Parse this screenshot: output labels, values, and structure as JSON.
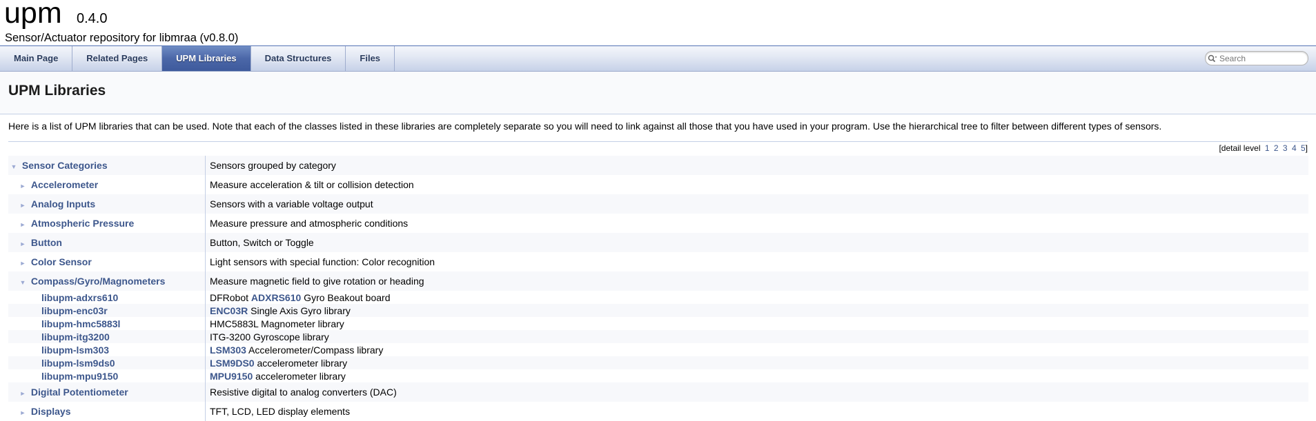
{
  "project": {
    "name": "upm",
    "number": "0.4.0",
    "brief": "Sensor/Actuator repository for libmraa (v0.8.0)"
  },
  "tabs": [
    {
      "label": "Main Page"
    },
    {
      "label": "Related Pages"
    },
    {
      "label": "UPM Libraries"
    },
    {
      "label": "Data Structures"
    },
    {
      "label": "Files"
    }
  ],
  "search": {
    "placeholder": "Search"
  },
  "page": {
    "title": "UPM Libraries",
    "intro": "Here is a list of UPM libraries that can be used. Note that each of the classes listed in these libraries are completely separate so you will need to link against all those that you have used in your program. Use the hierarchical tree to filter between different types of sensors.",
    "levels_prefix": "[detail level",
    "levels": [
      "1",
      "2",
      "3",
      "4",
      "5"
    ],
    "levels_suffix": "]"
  },
  "rows": [
    {
      "name": "Sensor Categories",
      "arrow": "▼",
      "desc": "Sensors grouped by category"
    },
    {
      "name": "Accelerometer",
      "arrow": "►",
      "desc": "Measure acceleration & tilt or collision detection"
    },
    {
      "name": "Analog Inputs",
      "arrow": "►",
      "desc": "Sensors with a variable voltage output"
    },
    {
      "name": "Atmospheric Pressure",
      "arrow": "►",
      "desc": "Measure pressure and atmospheric conditions"
    },
    {
      "name": "Button",
      "arrow": "►",
      "desc": "Button, Switch or Toggle"
    },
    {
      "name": "Color Sensor",
      "arrow": "►",
      "desc": "Light sensors with special function: Color recognition"
    },
    {
      "name": "Compass/Gyro/Magnometers",
      "arrow": "▼",
      "desc": "Measure magnetic field to give rotation or heading"
    },
    {
      "name": "libupm-adxrs610",
      "desc_before": "DFRobot ",
      "desc_link": "ADXRS610",
      "desc_after": " Gyro Beakout board"
    },
    {
      "name": "libupm-enc03r",
      "desc_before": "",
      "desc_link": "ENC03R",
      "desc_after": " Single Axis Gyro library"
    },
    {
      "name": "libupm-hmc5883l",
      "desc_before": "HMC5883L Magnometer library",
      "desc_link": "",
      "desc_after": ""
    },
    {
      "name": "libupm-itg3200",
      "desc_before": "ITG-3200 Gyroscope library",
      "desc_link": "",
      "desc_after": ""
    },
    {
      "name": "libupm-lsm303",
      "desc_before": "",
      "desc_link": "LSM303",
      "desc_after": " Accelerometer/Compass library"
    },
    {
      "name": "libupm-lsm9ds0",
      "desc_before": "",
      "desc_link": "LSM9DS0",
      "desc_after": " accelerometer library"
    },
    {
      "name": "libupm-mpu9150",
      "desc_before": "",
      "desc_link": "MPU9150",
      "desc_after": " accelerometer library"
    },
    {
      "name": "Digital Potentiometer",
      "arrow": "►",
      "desc": "Resistive digital to analog converters (DAC)"
    },
    {
      "name": "Displays",
      "arrow": "►",
      "desc": "TFT, LCD, LED display elements"
    }
  ]
}
